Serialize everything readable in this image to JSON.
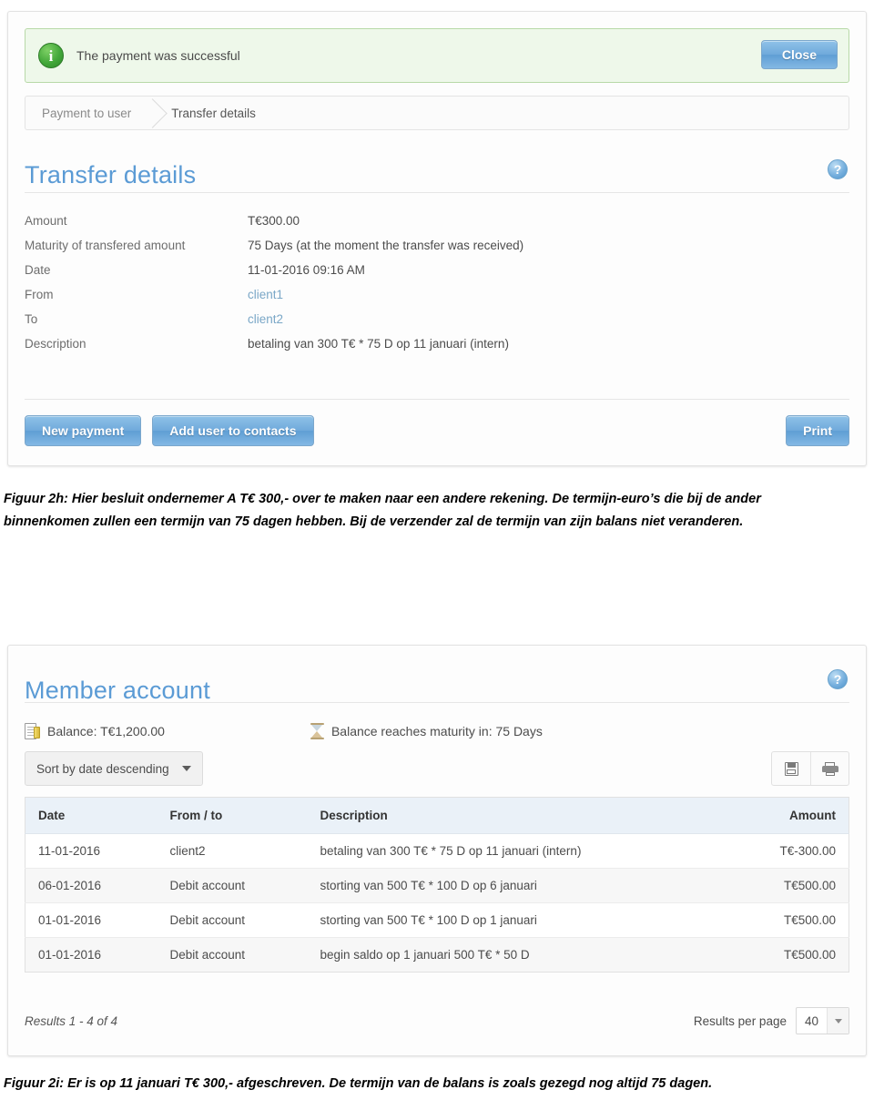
{
  "transfer_panel": {
    "alert": {
      "message": "The payment was successful",
      "icon": "info-icon",
      "close_label": "Close"
    },
    "breadcrumb": {
      "parent": "Payment to user",
      "current": "Transfer details"
    },
    "title": "Transfer details",
    "help_icon": "?",
    "details": [
      {
        "label": "Amount",
        "value": "T€300.00",
        "link": false
      },
      {
        "label": "Maturity of transfered amount",
        "value": "75 Days (at the moment the transfer was received)",
        "link": false
      },
      {
        "label": "Date",
        "value": "11-01-2016 09:16 AM",
        "link": false
      },
      {
        "label": "From",
        "value": "client1",
        "link": true
      },
      {
        "label": "To",
        "value": "client2",
        "link": true
      },
      {
        "label": "Description",
        "value": "betaling van 300 T€ * 75 D op 11 januari (intern)",
        "link": false
      }
    ],
    "actions": {
      "new_payment": "New payment",
      "add_user_to_contacts": "Add user to contacts",
      "print": "Print"
    }
  },
  "caption_2h": "Figuur 2h: Hier besluit ondernemer A T€ 300,- over te maken naar een andere rekening. De termijn-euro’s die bij de ander binnenkomen zullen een termijn van 75 dagen hebben. Bij de verzender zal de termijn van zijn balans niet veranderen.",
  "member_panel": {
    "title": "Member account",
    "help_icon": "?",
    "summary": {
      "balance": "Balance: T€1,200.00",
      "balance_icon": "ledger-icon",
      "maturity": "Balance reaches maturity in: 75 Days",
      "maturity_icon": "hourglass-icon"
    },
    "toolbar": {
      "sort_selected": "Sort by date descending",
      "save_icon": "floppy-disk-icon",
      "print_icon": "printer-icon"
    },
    "table": {
      "columns": [
        "Date",
        "From / to",
        "Description",
        "Amount"
      ],
      "rows": [
        {
          "date": "11-01-2016",
          "from_to": "client2",
          "description": "betaling van 300 T€ * 75 D op 11 januari (intern)",
          "amount": "T€-300.00",
          "negative": true
        },
        {
          "date": "06-01-2016",
          "from_to": "Debit account",
          "description": "storting van 500 T€ * 100 D op 6 januari",
          "amount": "T€500.00",
          "negative": false
        },
        {
          "date": "01-01-2016",
          "from_to": "Debit account",
          "description": "storting van 500 T€ * 100 D op 1 januari",
          "amount": "T€500.00",
          "negative": false
        },
        {
          "date": "01-01-2016",
          "from_to": "Debit account",
          "description": "begin saldo op 1 januari 500 T€ * 50 D",
          "amount": "T€500.00",
          "negative": false
        }
      ]
    },
    "footer": {
      "results": "Results 1 - 4 of 4",
      "results_per_page_label": "Results per page",
      "results_per_page_value": "40"
    }
  },
  "caption_2i": "Figuur 2i: Er is op 11 januari T€ 300,- afgeschreven. De termijn van de balans is zoals gezegd nog altijd 75 dagen.",
  "colors": {
    "accent_blue": "#5b9bd5",
    "alert_green_bg": "#eef8ea",
    "negative_red": "#cc4444",
    "table_header_bg": "#eaf1f8"
  }
}
